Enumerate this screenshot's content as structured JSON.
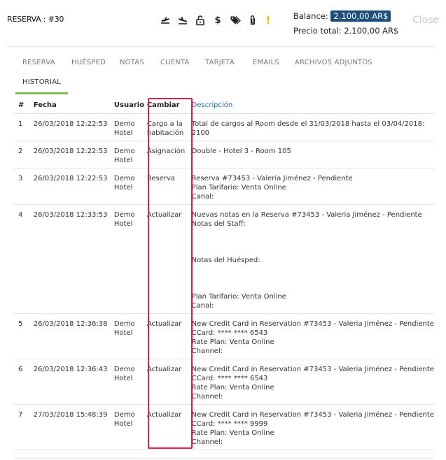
{
  "header": {
    "reservation_title": "RESERVA : #30",
    "balance_label": "Balance:",
    "balance_amount": "2.100,00 AR$",
    "total_label": "Precio total: 2.100,00 AR$",
    "close_label": "Close"
  },
  "toolbar": {
    "icons": [
      "plane-departure-icon",
      "plane-arrival-icon",
      "unlock-icon",
      "dollar-icon",
      "tags-icon",
      "paperclip-icon",
      "exclamation-icon"
    ],
    "dollar_glyph": "$",
    "exclamation_glyph": "!",
    "warning_color": "#f0c000"
  },
  "tabs": [
    {
      "label": "RESERVA"
    },
    {
      "label": "HUÉSPED"
    },
    {
      "label": "NOTAS"
    },
    {
      "label": "CUENTA"
    },
    {
      "label": "TARJETA"
    },
    {
      "label": "EMAILS"
    },
    {
      "label": "ARCHIVOS ADJUNTOS"
    },
    {
      "label": "HISTORIAL",
      "active": true
    }
  ],
  "table": {
    "headers": {
      "num": "#",
      "fecha": "Fecha",
      "usuario": "Usuario",
      "cambiar": "Cambiar",
      "descripcion": "Descripción"
    },
    "rows": [
      {
        "num": "1",
        "fecha": "26/03/2018 12:22:53",
        "usuario": [
          "Demo",
          "Hotel"
        ],
        "cambiar": [
          "Cargo a la",
          "habitación"
        ],
        "descripcion": [
          "Total de cargos al Room desde el 31/03/2018 hasta el 03/04/2018:",
          "2100"
        ]
      },
      {
        "num": "2",
        "fecha": "26/03/2018 12:22:53",
        "usuario": [
          "Demo",
          "Hotel"
        ],
        "cambiar": [
          "Asignación"
        ],
        "descripcion": [
          "Double - Hotel 3 - Room 105"
        ]
      },
      {
        "num": "3",
        "fecha": "26/03/2018 12:22:53",
        "usuario": [
          "Demo",
          "Hotel"
        ],
        "cambiar": [
          "Reserva"
        ],
        "descripcion": [
          "Reserva #73453 - Valeria Jiménez - Pendiente",
          "Plan Tarifario: Venta Online",
          "Canal:"
        ]
      },
      {
        "num": "4",
        "fecha": "26/03/2018 12:33:53",
        "usuario": [
          "Demo",
          "Hotel"
        ],
        "cambiar": [
          "Actualizar"
        ],
        "descripcion": [
          "Nuevas notas en la Reserva #73453 - Valeria Jiménez - Pendiente",
          "Notas del Staff:",
          "",
          "",
          "",
          "Notas del Huésped:",
          "",
          "",
          "",
          "Plan Tarifario: Venta Online",
          "Canal:"
        ]
      },
      {
        "num": "5",
        "fecha": "26/03/2018 12:36:38",
        "usuario": [
          "Demo",
          "Hotel"
        ],
        "cambiar": [
          "Actualizar"
        ],
        "descripcion": [
          "New Credit Card in Reservation #73453 - Valeria Jiménez - Pendiente",
          "CCard: **** **** 6543",
          "Rate Plan: Venta Online",
          "Channel:"
        ]
      },
      {
        "num": "6",
        "fecha": "26/03/2018 12:36:43",
        "usuario": [
          "Demo",
          "Hotel"
        ],
        "cambiar": [
          "Actualizar"
        ],
        "descripcion": [
          "New Credit Card in Reservation #73453 - Valeria Jiménez - Pendiente",
          "CCard: **** **** 6543",
          "Rate Plan: Venta Online",
          "Channel:"
        ]
      },
      {
        "num": "7",
        "fecha": "27/03/2018 15:48:39",
        "usuario": [
          "Demo",
          "Hotel"
        ],
        "cambiar": [
          "Actualizar"
        ],
        "descripcion": [
          "New Credit Card in Reservation #73453 - Valeria Jiménez - Pendiente",
          "CCard: **** **** 9999",
          "Rate Plan: Venta Online",
          "Channel:"
        ]
      }
    ]
  },
  "highlight_color": "#e8194b",
  "accent_color": "#7dbb4f"
}
